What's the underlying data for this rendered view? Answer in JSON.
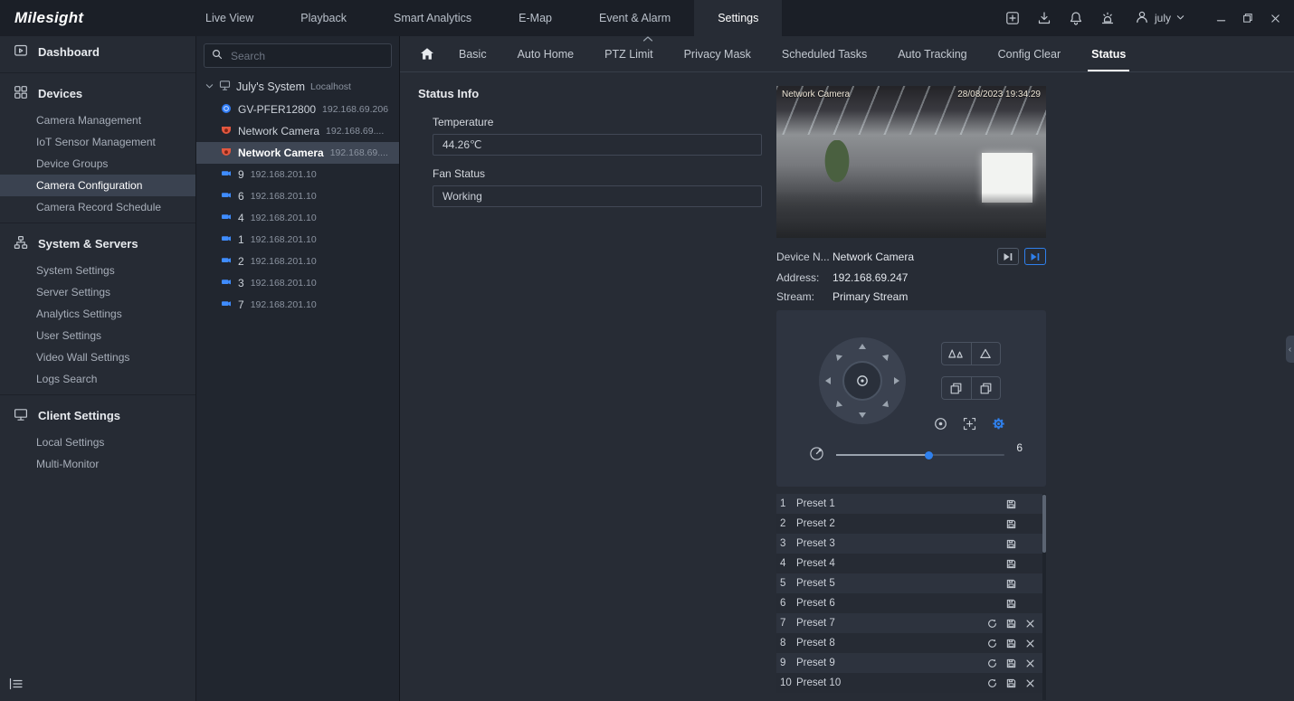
{
  "colors": {
    "accent_blue": "#2f80ed",
    "camera_icon_blue": "#3f8cff",
    "camera_icon_red": "#e2573f"
  },
  "topbar": {
    "logo": "Milesight",
    "nav": [
      {
        "label": "Live View"
      },
      {
        "label": "Playback"
      },
      {
        "label": "Smart Analytics"
      },
      {
        "label": "E-Map"
      },
      {
        "label": "Event & Alarm"
      },
      {
        "label": "Settings"
      }
    ],
    "user_name": "july"
  },
  "sidebar": {
    "sections": [
      {
        "label": "Dashboard"
      },
      {
        "label": "Devices",
        "items": [
          "Camera Management",
          "IoT Sensor Management",
          "Device Groups",
          "Camera Configuration",
          "Camera Record Schedule"
        ]
      },
      {
        "label": "System & Servers",
        "items": [
          "System Settings",
          "Server Settings",
          "Analytics Settings",
          "User Settings",
          "Video Wall Settings",
          "Logs Search"
        ]
      },
      {
        "label": "Client Settings",
        "items": [
          "Local Settings",
          "Multi-Monitor"
        ]
      }
    ]
  },
  "device_tree": {
    "search_placeholder": "Search",
    "root": {
      "name": "July's System",
      "tag": "Localhost"
    },
    "devices": [
      {
        "name": "GV-PFER12800",
        "ip": "192.168.69.206"
      },
      {
        "name": "Network Camera",
        "ip": "192.168.69...."
      },
      {
        "name": "Network Camera",
        "ip": "192.168.69...."
      },
      {
        "name": "9",
        "ip": "192.168.201.10"
      },
      {
        "name": "6",
        "ip": "192.168.201.10"
      },
      {
        "name": "4",
        "ip": "192.168.201.10"
      },
      {
        "name": "1",
        "ip": "192.168.201.10"
      },
      {
        "name": "2",
        "ip": "192.168.201.10"
      },
      {
        "name": "3",
        "ip": "192.168.201.10"
      },
      {
        "name": "7",
        "ip": "192.168.201.10"
      }
    ]
  },
  "config_tabs": {
    "items": [
      "Basic",
      "Auto Home",
      "PTZ Limit",
      "Privacy Mask",
      "Scheduled Tasks",
      "Auto Tracking",
      "Config Clear",
      "Status"
    ]
  },
  "status_info": {
    "title": "Status Info",
    "temperature_label": "Temperature",
    "temperature_value": "44.26℃",
    "fan_label": "Fan Status",
    "fan_value": "Working"
  },
  "preview": {
    "osd_name": "Network Camera",
    "osd_time": "28/08/2023 19:34:29",
    "device_label": "Device N...",
    "device_name": "Network Camera",
    "address_label": "Address:",
    "address": "192.168.69.247",
    "stream_label": "Stream:",
    "stream": "Primary Stream"
  },
  "ptz": {
    "speed": "6"
  },
  "presets": {
    "rows": [
      {
        "no": "1",
        "label": "Preset 1"
      },
      {
        "no": "2",
        "label": "Preset 2"
      },
      {
        "no": "3",
        "label": "Preset 3"
      },
      {
        "no": "4",
        "label": "Preset 4"
      },
      {
        "no": "5",
        "label": "Preset 5"
      },
      {
        "no": "6",
        "label": "Preset 6"
      },
      {
        "no": "7",
        "label": "Preset 7"
      },
      {
        "no": "8",
        "label": "Preset 8"
      },
      {
        "no": "9",
        "label": "Preset 9"
      },
      {
        "no": "10",
        "label": "Preset 10"
      }
    ]
  }
}
